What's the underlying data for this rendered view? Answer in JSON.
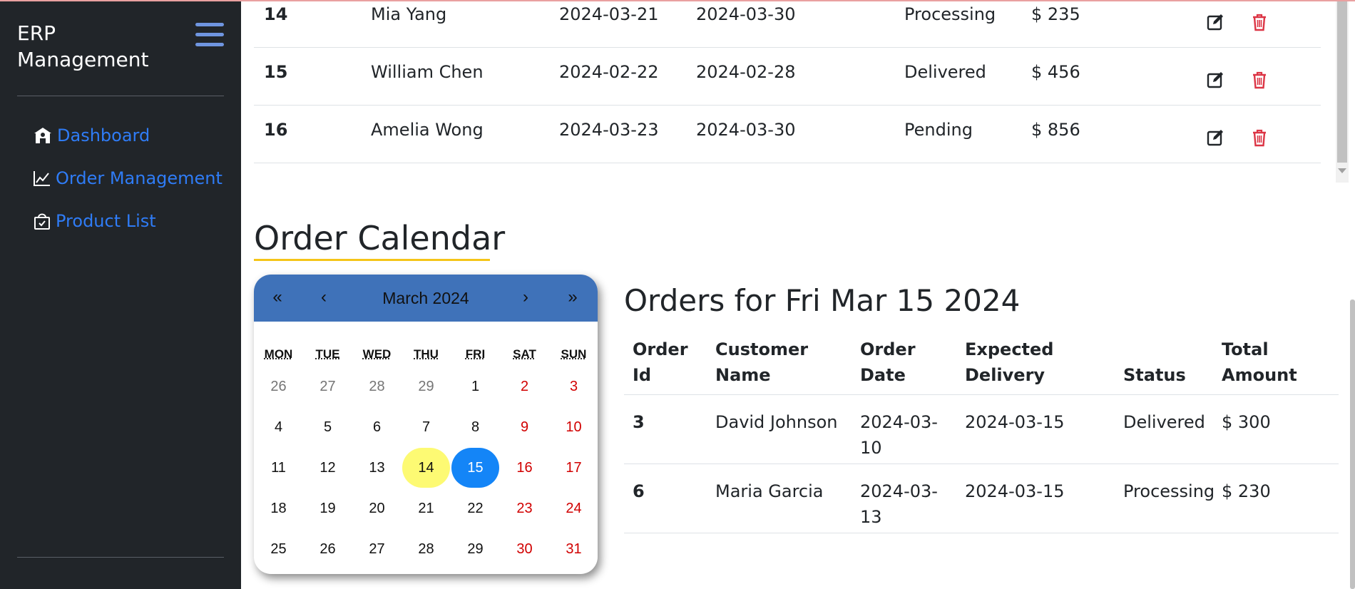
{
  "app": {
    "brand": "ERP Management",
    "menu_icon": "hamburger-menu-icon"
  },
  "sidebar": {
    "items": [
      {
        "label": "Dashboard",
        "icon": "shop-icon"
      },
      {
        "label": "Order Management",
        "icon": "graph-up-icon"
      },
      {
        "label": "Product List",
        "icon": "bag-check-icon"
      }
    ]
  },
  "orders_table": {
    "rows": [
      {
        "id": "14",
        "customer": "Mia Yang",
        "order_date": "2024-03-21",
        "expected": "2024-03-30",
        "status": "Processing",
        "total": "$ 235"
      },
      {
        "id": "15",
        "customer": "William Chen",
        "order_date": "2024-02-22",
        "expected": "2024-02-28",
        "status": "Delivered",
        "total": "$ 456"
      },
      {
        "id": "16",
        "customer": "Amelia Wong",
        "order_date": "2024-03-23",
        "expected": "2024-03-30",
        "status": "Pending",
        "total": "$ 856"
      }
    ],
    "edit_icon": "edit-icon",
    "delete_icon": "trash-icon",
    "colors": {
      "delete": "#dc3545",
      "edit": "#212529"
    }
  },
  "calendar_section": {
    "title": "Order Calendar",
    "calendar": {
      "nav_prev_year": "«",
      "nav_prev_month": "‹",
      "month_label": "March 2024",
      "nav_next_month": "›",
      "nav_next_year": "»",
      "weekdays": [
        "MON",
        "TUE",
        "WED",
        "THU",
        "FRI",
        "SAT",
        "SUN"
      ],
      "weeks": [
        [
          "26",
          "27",
          "28",
          "29",
          "1",
          "2",
          "3"
        ],
        [
          "4",
          "5",
          "6",
          "7",
          "8",
          "9",
          "10"
        ],
        [
          "11",
          "12",
          "13",
          "14",
          "15",
          "16",
          "17"
        ],
        [
          "18",
          "19",
          "20",
          "21",
          "22",
          "23",
          "24"
        ],
        [
          "25",
          "26",
          "27",
          "28",
          "29",
          "30",
          "31"
        ]
      ],
      "today": "14",
      "selected": "15",
      "colors": {
        "header": "#3f72b9",
        "today": "#fdfa73",
        "selected": "#1485f7",
        "weekend": "#d10000"
      }
    }
  },
  "orders_for_date": {
    "title": "Orders for Fri Mar 15 2024",
    "headers": [
      "Order Id",
      "Customer Name",
      "Order Date",
      "Expected Delivery",
      "Status",
      "Total Amount"
    ],
    "rows": [
      {
        "id": "3",
        "customer": "David Johnson",
        "order_date": "2024-03-10",
        "expected": "2024-03-15",
        "status": "Delivered",
        "total": "$ 300"
      },
      {
        "id": "6",
        "customer": "Maria Garcia",
        "order_date": "2024-03-13",
        "expected": "2024-03-15",
        "status": "Processing",
        "total": "$ 230"
      }
    ]
  }
}
